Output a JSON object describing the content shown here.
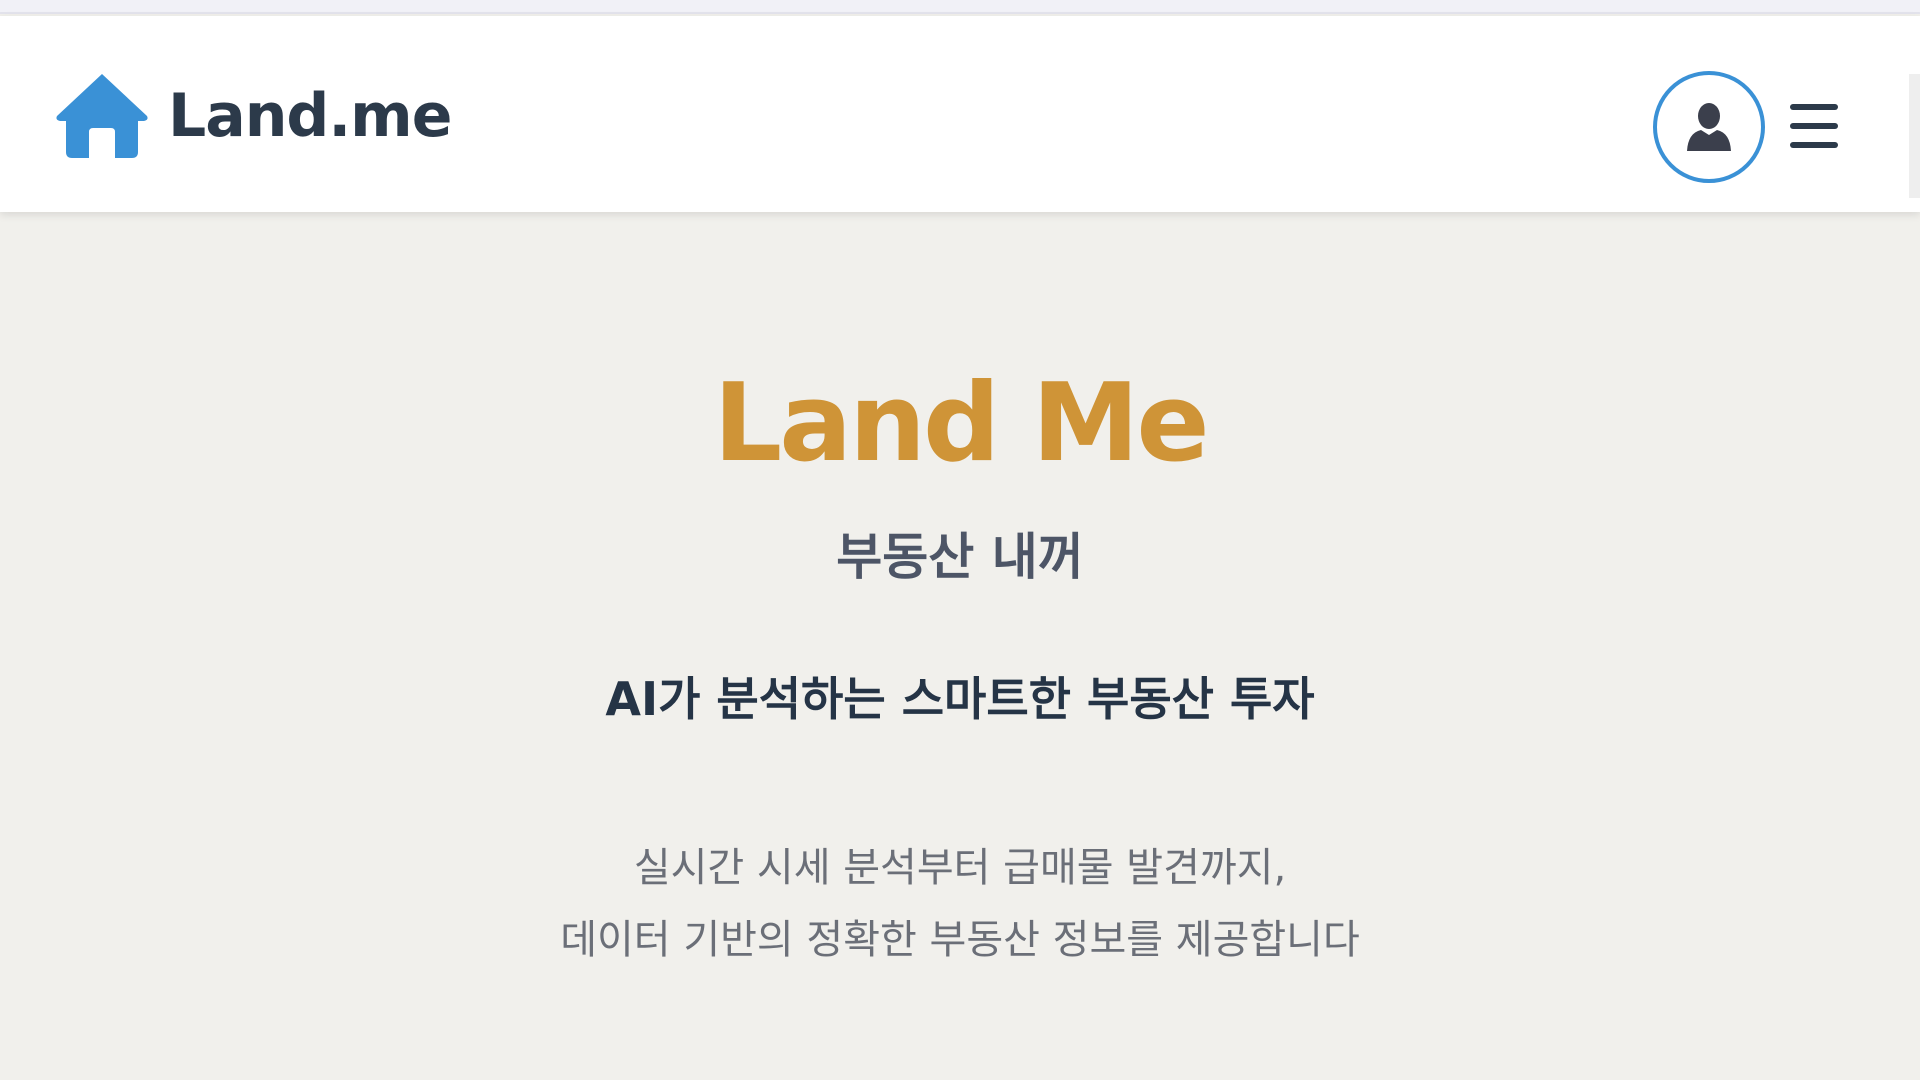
{
  "header": {
    "logo_text": "Land.me",
    "logo_icon": "home-icon",
    "profile_icon": "user-icon",
    "menu_icon": "hamburger-menu-icon"
  },
  "hero": {
    "title": "Land Me",
    "subtitle": "부동산 내꺼",
    "tagline": "AI가 분석하는 스마트한 부동산 투자",
    "description": [
      "실시간 시세 분석부터 급매물 발견까지,",
      "데이터 기반의 정확한 부동산 정보를 제공합니다"
    ]
  },
  "colors": {
    "brand_blue": "#3a91d6",
    "title_gold": "#cf9437",
    "text_dark": "#2c3a4a",
    "background": "#f1f0ec"
  }
}
